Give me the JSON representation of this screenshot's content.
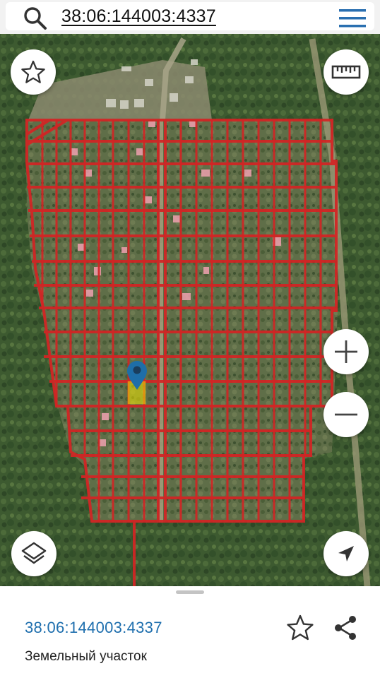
{
  "search": {
    "query": "38:06:144003:4337",
    "icon": "search-icon"
  },
  "header": {
    "menu_icon": "hamburger-menu-icon"
  },
  "map": {
    "overlay_color": "#d42424",
    "selected_parcel_color": "#f2e600",
    "marker_color": "#1e6ea8",
    "controls": {
      "favorite_icon": "star-icon",
      "ruler_icon": "ruler-icon",
      "zoom_in_icon": "plus-icon",
      "zoom_out_icon": "minus-icon",
      "layers_icon": "layers-icon",
      "locate_icon": "navigation-arrow-icon"
    }
  },
  "parcel": {
    "cadastral_number": "38:06:144003:4337",
    "type": "Земельный участок",
    "accent_color": "#1f6fae"
  },
  "actions": {
    "favorite_icon": "star-icon",
    "share_icon": "share-icon"
  }
}
